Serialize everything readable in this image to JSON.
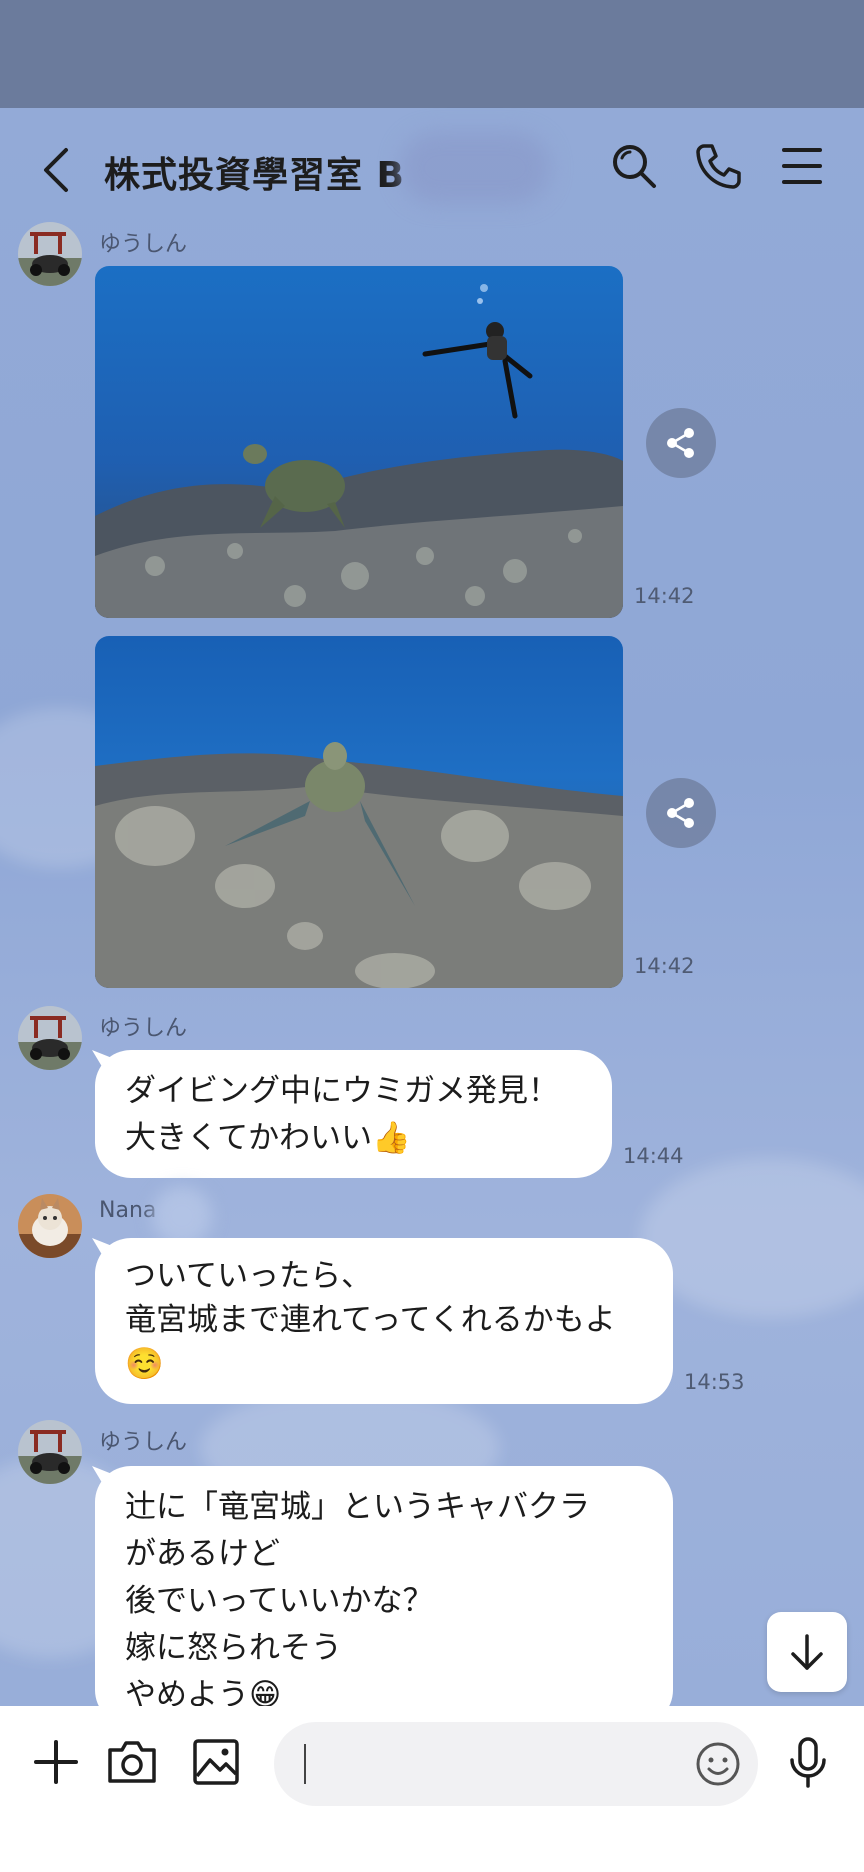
{
  "header": {
    "title": "株式投資學習室 B"
  },
  "messages": [
    {
      "sender": "ゆうしん",
      "time": "14:42"
    },
    {
      "time": "14:42"
    },
    {
      "sender": "ゆうしん",
      "lines": [
        "ダイビング中にウミガメ発見！",
        "大きくてかわいい👍"
      ],
      "time": "14:44"
    },
    {
      "sender": "Nana",
      "lines": [
        "ついていったら、",
        "竜宮城まで連れてってくれるかもよ",
        "☺️"
      ],
      "time": "14:53"
    },
    {
      "sender": "ゆうしん",
      "lines": [
        "辻に「竜宮城」というキャバクラ",
        "があるけど",
        "後でいっていいかな？",
        "嫁に怒られそう",
        "やめよう😁"
      ]
    }
  ],
  "input": {
    "value": "",
    "placeholder": ""
  },
  "icons": {
    "back": "chevron-left-icon",
    "search": "search-icon",
    "call": "phone-icon",
    "menu": "menu-icon",
    "share": "share-icon",
    "scroll_down": "arrow-down-icon",
    "add": "plus-icon",
    "camera": "camera-icon",
    "gallery": "image-icon",
    "emoji": "emoji-icon",
    "mic": "mic-icon"
  },
  "colors": {
    "status_bar": "#6b7b9c",
    "chat_background": "#8ea6d6",
    "bubble": "#ffffff",
    "input_bar": "#ffffff"
  }
}
